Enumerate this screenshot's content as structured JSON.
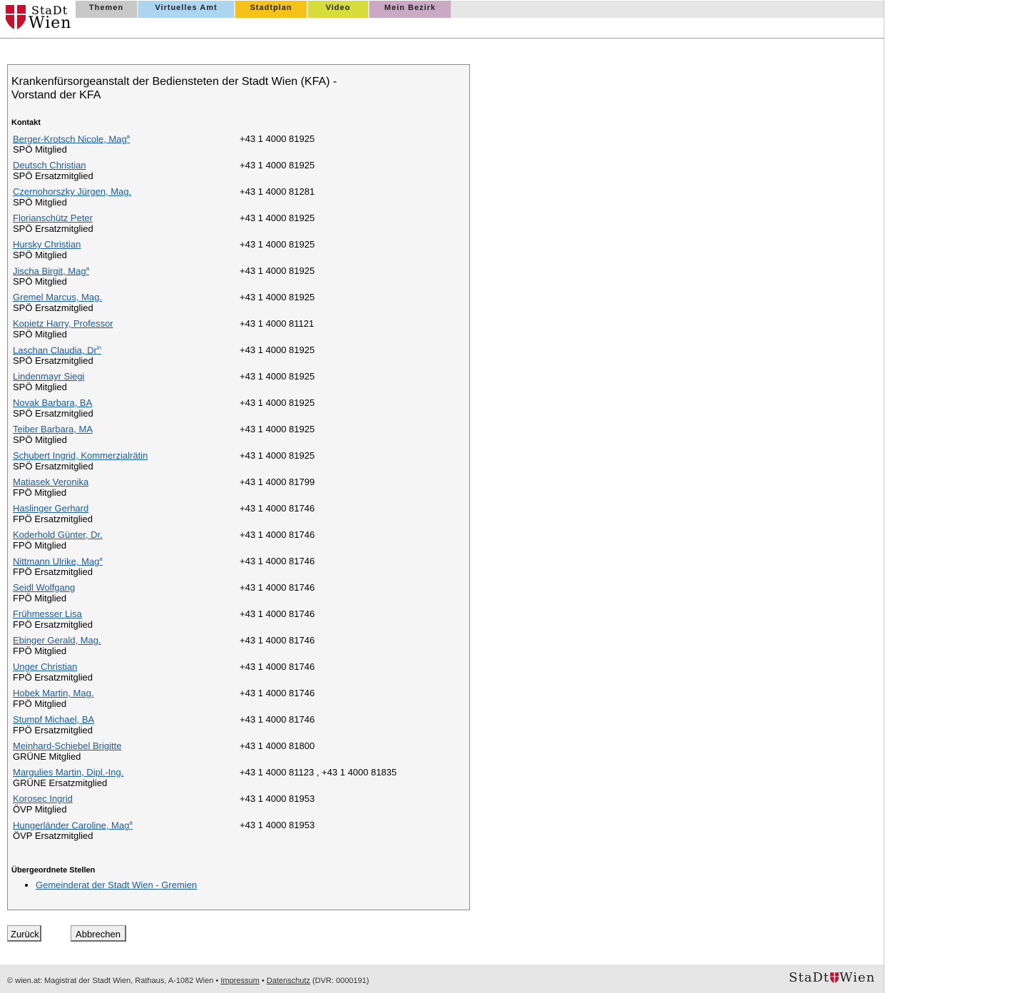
{
  "logo": {
    "line1": "StaDt",
    "line2": "Wien"
  },
  "nav": {
    "tabs": [
      {
        "label": "Themen",
        "color": "#c8c8c8"
      },
      {
        "label": "Virtuelles Amt",
        "color": "#acd6f0"
      },
      {
        "label": "Stadtplan",
        "color": "#f5c21a"
      },
      {
        "label": "Video",
        "color": "#d6dd3a"
      },
      {
        "label": "Mein Bezirk",
        "color": "#c9a9c4"
      }
    ]
  },
  "main": {
    "title": "Krankenfürsorgeanstalt der Bediensteten der Stadt Wien (KFA) - Vorstand der KFA",
    "contact_heading": "Kontakt",
    "contacts": [
      {
        "name": "Berger-Krotsch Nicole, Mag",
        "sup": "a",
        "role": "SPÖ Mitglied",
        "phone": "+43 1 4000 81925"
      },
      {
        "name": "Deutsch Christian",
        "sup": "",
        "role": "SPÖ Ersatzmitglied",
        "phone": "+43 1 4000 81925"
      },
      {
        "name": "Czernohorszky Jürgen, Mag.",
        "sup": "",
        "role": "SPÖ Mitglied",
        "phone": "+43 1 4000 81281"
      },
      {
        "name": "Florianschütz Peter",
        "sup": "",
        "role": "SPÖ Ersatzmitglied",
        "phone": "+43 1 4000 81925"
      },
      {
        "name": "Hursky Christian",
        "sup": "",
        "role": "SPÖ Mitglied",
        "phone": "+43 1 4000 81925"
      },
      {
        "name": "Jischa Birgit, Mag",
        "sup": "a",
        "role": "SPÖ Mitglied",
        "phone": "+43 1 4000 81925"
      },
      {
        "name": "Gremel Marcus, Mag.",
        "sup": "",
        "role": "SPÖ Ersatzmitglied",
        "phone": "+43 1 4000 81925"
      },
      {
        "name": "Kopietz Harry, Professor",
        "sup": "",
        "role": "SPÖ Mitglied",
        "phone": "+43 1 4000 81121"
      },
      {
        "name": "Laschan Claudia, Dr",
        "sup": "in",
        "role": "SPÖ Ersatzmitglied",
        "phone": "+43 1 4000 81925"
      },
      {
        "name": "Lindenmayr Siegi",
        "sup": "",
        "role": "SPÖ Mitglied",
        "phone": "+43 1 4000 81925"
      },
      {
        "name": "Novak Barbara, BA",
        "sup": "",
        "role": "SPÖ Ersatzmitglied",
        "phone": "+43 1 4000 81925"
      },
      {
        "name": "Teiber Barbara, MA",
        "sup": "",
        "role": "SPÖ Mitglied",
        "phone": "+43 1 4000 81925"
      },
      {
        "name": "Schubert Ingrid, Kommerzialrätin",
        "sup": "",
        "role": "SPÖ Ersatzmitglied",
        "phone": "+43 1 4000 81925"
      },
      {
        "name": "Matiasek Veronika",
        "sup": "",
        "role": "FPÖ Mitglied",
        "phone": "+43 1 4000 81799"
      },
      {
        "name": "Haslinger Gerhard",
        "sup": "",
        "role": "FPÖ Ersatzmitglied",
        "phone": "+43 1 4000 81746"
      },
      {
        "name": "Koderhold Günter, Dr.",
        "sup": "",
        "role": "FPÖ Mitglied",
        "phone": "+43 1 4000 81746"
      },
      {
        "name": "Nittmann Ulrike, Mag",
        "sup": "a",
        "role": "FPÖ Ersatzmitglied",
        "phone": "+43 1 4000 81746"
      },
      {
        "name": "Seidl Wolfgang",
        "sup": "",
        "role": "FPÖ Mitglied",
        "phone": "+43 1 4000 81746"
      },
      {
        "name": "Frühmesser Lisa",
        "sup": "",
        "role": "FPÖ Ersatzmitglied",
        "phone": "+43 1 4000 81746"
      },
      {
        "name": "Ebinger Gerald, Mag.",
        "sup": "",
        "role": "FPÖ Mitglied",
        "phone": "+43 1 4000 81746"
      },
      {
        "name": "Unger Christian",
        "sup": "",
        "role": "FPÖ Ersatzmitglied",
        "phone": "+43 1 4000 81746"
      },
      {
        "name": "Hobek Martin, Mag.",
        "sup": "",
        "role": "FPÖ Mitglied",
        "phone": "+43 1 4000 81746"
      },
      {
        "name": "Stumpf Michael, BA",
        "sup": "",
        "role": "FPÖ Ersatzmitglied",
        "phone": "+43 1 4000 81746"
      },
      {
        "name": "Meinhard-Schiebel Brigitte",
        "sup": "",
        "role": "GRÜNE Mitglied",
        "phone": "+43 1 4000 81800"
      },
      {
        "name": "Margulies Martin, Dipl.-Ing.",
        "sup": "",
        "role": "GRÜNE Ersatzmitglied",
        "phone": "+43 1 4000 81123 , +43 1 4000 81835"
      },
      {
        "name": "Korosec Ingrid",
        "sup": "",
        "role": "ÖVP Mitglied",
        "phone": "+43 1 4000 81953"
      },
      {
        "name": "Hungerländer Caroline, Mag",
        "sup": "a",
        "role": "ÖVP Ersatzmitglied",
        "phone": "+43 1 4000 81953"
      }
    ],
    "parent_heading": "Übergeordnete Stellen",
    "parent_links": [
      "Gemeinderat der Stadt Wien - Gremien"
    ]
  },
  "buttons": {
    "back": "Zurück",
    "cancel": "Abbrechen"
  },
  "footer": {
    "copyright": "© wien.at: Magistrat der Stadt Wien, Rathaus, A-1082 Wien",
    "separator": "•",
    "impressum": "Impressum",
    "datenschutz": "Datenschutz",
    "dvr": "(DVR: 0000191)",
    "logo_left": "StaDt",
    "logo_right": "Wien"
  },
  "colors": {
    "link": "#1a5c9a",
    "shield_red": "#c8102e"
  }
}
